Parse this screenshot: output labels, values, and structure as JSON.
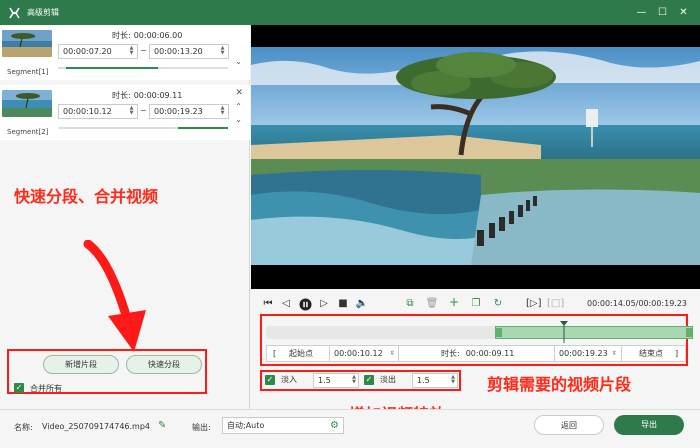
{
  "window": {
    "title": "高级剪辑",
    "minimize": "—",
    "maximize": "☐",
    "close": "✕"
  },
  "segments": [
    {
      "label": "Segment[1]",
      "duration_label": "时长:",
      "duration": "00:00:06.00",
      "start": "00:00:07.20",
      "end": "00:00:13.20"
    },
    {
      "label": "Segment[2]",
      "duration_label": "时长:",
      "duration": "00:00:09.11",
      "start": "00:00:10.12",
      "end": "00:00:19.23"
    }
  ],
  "left_panel": {
    "add_segment": "新增片段",
    "fast_split": "快速分段",
    "merge_all": "合并所有"
  },
  "annotations": {
    "split_merge": "快速分段、合并视频",
    "clip_segment": "剪辑需要的视频片段",
    "add_effects": "增加视频特效"
  },
  "player": {
    "time_display": "00:00:14.05/00:00:19.23"
  },
  "trim": {
    "start_label": "起始点",
    "start_value": "00:00:10.12",
    "duration_label": "时长:",
    "duration_value": "00:00:09.11",
    "end_value": "00:00:19.23",
    "end_label": "结束点",
    "selection_start": 0.52,
    "selection_end": 1.0,
    "playhead": 0.71
  },
  "effects": {
    "fade_in_label": "淡入",
    "fade_in_value": "1.5",
    "fade_out_label": "淡出",
    "fade_out_value": "1.5"
  },
  "footer": {
    "name_label": "名称:",
    "name_value": "Video_250709174746.mp4",
    "output_label": "输出:",
    "output_value": "自动;Auto",
    "back": "返回",
    "export": "导出"
  },
  "colors": {
    "brand": "#2f7a4a",
    "annotation": "#ff2a1a",
    "selection": "#a8d7b0"
  }
}
